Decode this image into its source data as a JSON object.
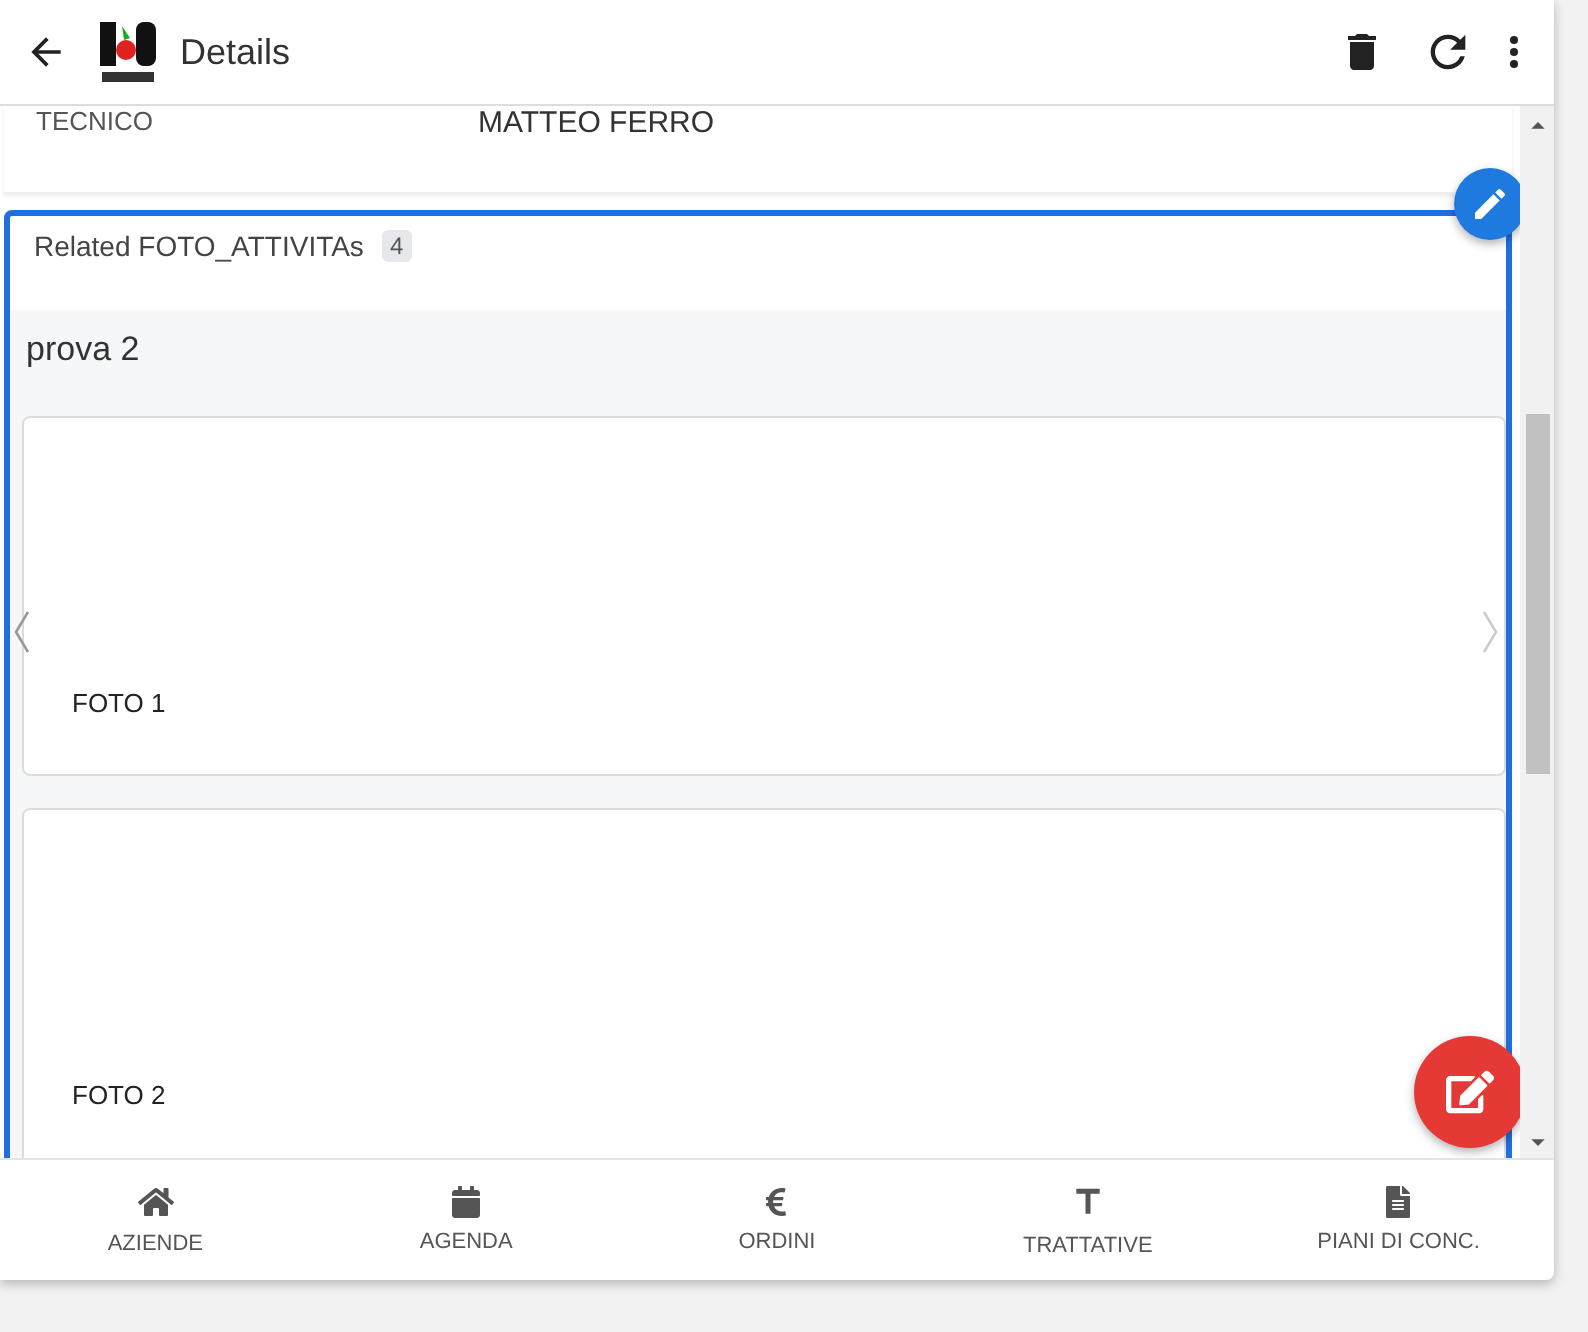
{
  "header": {
    "title": "Details"
  },
  "record_field": {
    "label": "TECNICO",
    "value": "MATTEO FERRO"
  },
  "related": {
    "title": "Related FOTO_ATTIVITAs",
    "count": "4",
    "group": "prova 2",
    "photos": [
      {
        "caption": "FOTO 1"
      },
      {
        "caption": "FOTO 2"
      }
    ]
  },
  "bottom_nav": [
    {
      "label": "AZIENDE",
      "kind": "home"
    },
    {
      "label": "AGENDA",
      "kind": "calendar"
    },
    {
      "label": "ORDINI",
      "kind": "euro"
    },
    {
      "label": "TRATTATIVE",
      "kind": "text"
    },
    {
      "label": "PIANI DI CONC.",
      "kind": "document"
    }
  ]
}
